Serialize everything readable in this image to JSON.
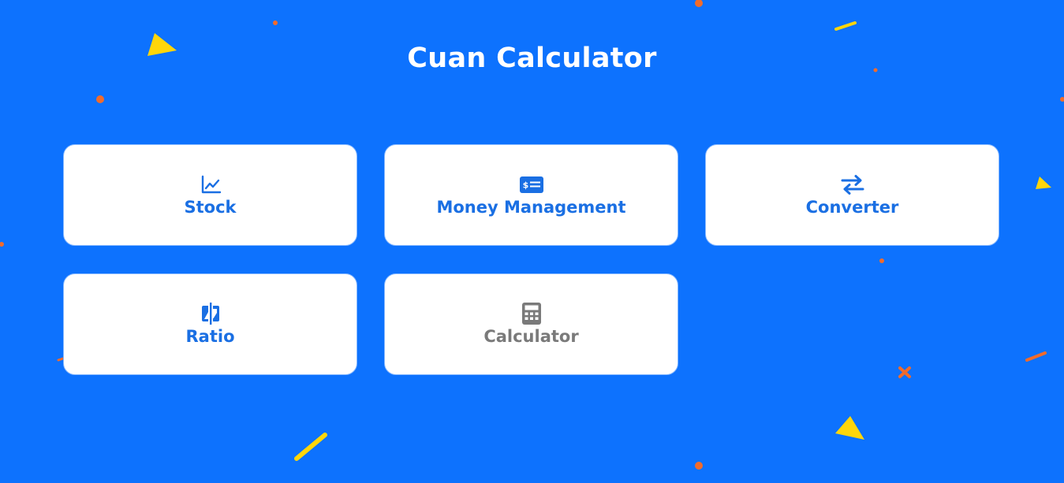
{
  "app": {
    "title": "Cuan Calculator"
  },
  "menu": [
    {
      "label": "Stock",
      "icon": "stock-chart-icon",
      "state": "active"
    },
    {
      "label": "Money Management",
      "icon": "money-bill-icon",
      "state": "active"
    },
    {
      "label": "Converter",
      "icon": "swap-arrows-icon",
      "state": "active"
    },
    {
      "label": "Ratio",
      "icon": "compare-icon",
      "state": "active"
    },
    {
      "label": "Calculator",
      "icon": "calculator-icon",
      "state": "disabled"
    }
  ],
  "colors": {
    "background": "#0d72fe",
    "card": "#ffffff",
    "accent": "#1a6fe3",
    "muted": "#7a7a7a",
    "confetti_orange": "#f26b2b",
    "confetti_yellow": "#ffd60a"
  }
}
